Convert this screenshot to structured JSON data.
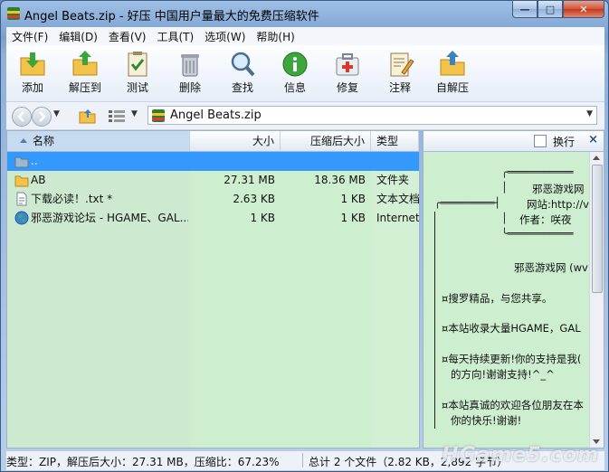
{
  "window": {
    "title": "Angel Beats.zip - 好压 中国用户量最大的免费压缩软件",
    "buttons": {
      "minimize": "—",
      "maximize": "□",
      "close": "✕"
    }
  },
  "menu": {
    "items": [
      "文件(F)",
      "编辑(D)",
      "查看(V)",
      "工具(T)",
      "选项(W)",
      "帮助(H)"
    ]
  },
  "toolbar": {
    "items": [
      {
        "label": "添加",
        "icon": "add-icon"
      },
      {
        "label": "解压到",
        "icon": "extract-to-icon"
      },
      {
        "label": "测试",
        "icon": "test-icon"
      },
      {
        "label": "删除",
        "icon": "delete-icon"
      },
      {
        "label": "查找",
        "icon": "find-icon"
      },
      {
        "label": "信息",
        "icon": "info-icon"
      },
      {
        "label": "修复",
        "icon": "repair-icon"
      },
      {
        "label": "注释",
        "icon": "comment-icon"
      },
      {
        "label": "自解压",
        "icon": "sfx-icon"
      }
    ]
  },
  "address": {
    "path": "Angel Beats.zip"
  },
  "filelist": {
    "columns": {
      "name": "名称",
      "size": "大小",
      "packed": "压缩后大小",
      "type": "类型"
    },
    "rows": [
      {
        "name": "..",
        "size": "",
        "packed": "",
        "type": "",
        "icon": "parent-folder-icon",
        "selected": true
      },
      {
        "name": "AB",
        "size": "27.31 MB",
        "packed": "18.36 MB",
        "type": "文件夹",
        "icon": "folder-icon",
        "selected": false
      },
      {
        "name": "下载必读！.txt *",
        "size": "2.63 KB",
        "packed": "1 KB",
        "type": "文本文档",
        "icon": "text-file-icon",
        "selected": false
      },
      {
        "name": "邪恶游戏论坛 - HGAME、GAL...",
        "size": "1 KB",
        "packed": "1 KB",
        "type": "Internet",
        "icon": "internet-shortcut-icon",
        "selected": false
      }
    ]
  },
  "comment": {
    "wrap_label": "换行",
    "close": "×",
    "box_top": "╭═══════════",
    "box_site": "邪恶游戏网",
    "box_url": "网站:http://v",
    "box_left": "╭═════════┤",
    "box_author": "作者：咲夜",
    "box_bottom": "╰═══════════",
    "site_line": "邪恶游戏网 (wv",
    "lines": [
      "¤搜罗精品，与您共享。",
      "¤本站收录大量HGAME，GAL",
      "¤每天持续更新!你的支持是我(",
      "的方向!谢谢支持!^_^",
      "¤本站真诚的欢迎各位朋友在本",
      "你的快乐!谢谢!"
    ]
  },
  "status": {
    "left": "类型：ZIP，解压后大小：27.31 MB，压缩比：67.23%",
    "right": "总计 2 个文件（2.82 KB，2,892 字节）",
    "watermark": "HGame5.com"
  }
}
